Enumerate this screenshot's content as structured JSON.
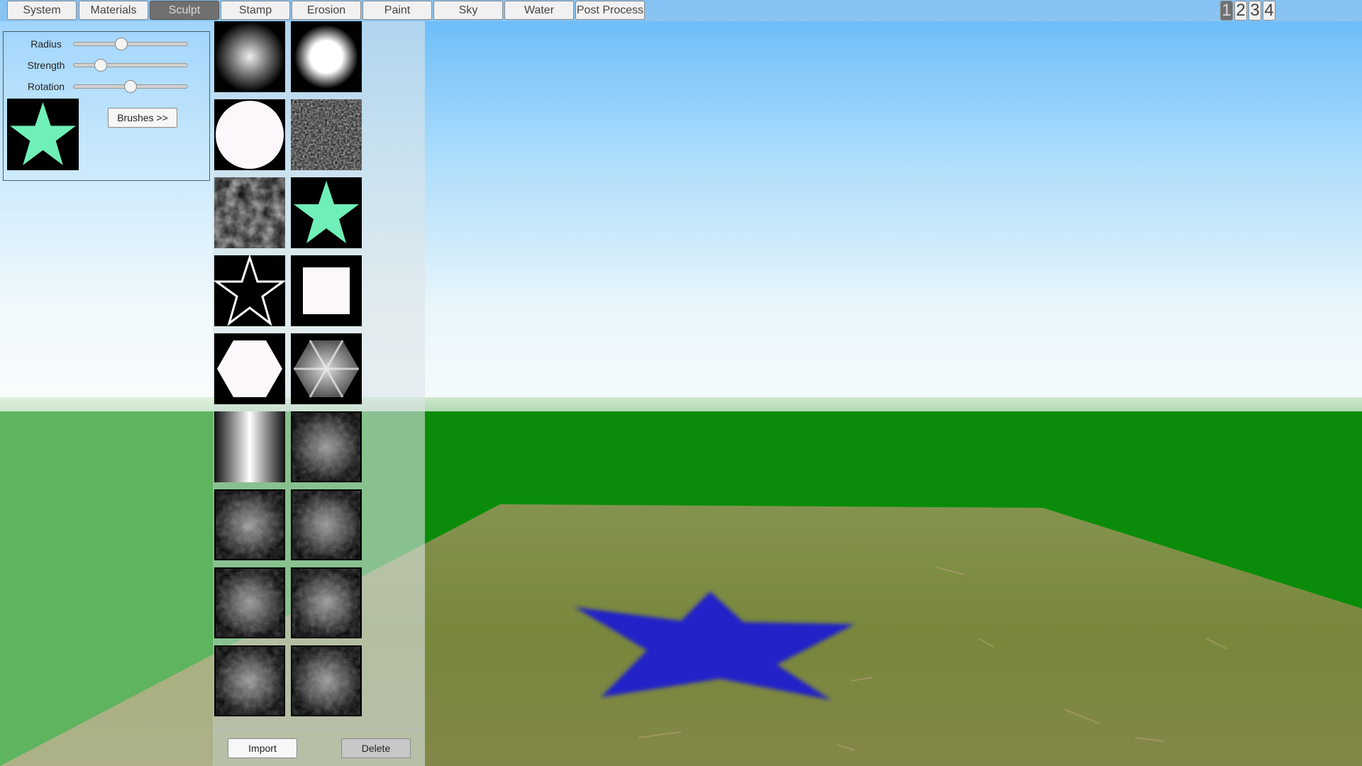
{
  "menu": {
    "tabs": [
      {
        "label": "System"
      },
      {
        "label": "Materials"
      },
      {
        "label": "Sculpt",
        "active": true
      },
      {
        "label": "Stamp"
      },
      {
        "label": "Erosion"
      },
      {
        "label": "Paint"
      },
      {
        "label": "Sky"
      },
      {
        "label": "Water"
      },
      {
        "label": "Post Process"
      }
    ],
    "viewports": [
      {
        "label": "1",
        "active": true
      },
      {
        "label": "2"
      },
      {
        "label": "3"
      },
      {
        "label": "4"
      }
    ]
  },
  "sculpt_panel": {
    "sliders": [
      {
        "label": "Radius",
        "value": 0.42
      },
      {
        "label": "Strength",
        "value": 0.24
      },
      {
        "label": "Rotation",
        "value": 0.5
      }
    ],
    "brushes_button": "Brushes >>",
    "current_brush_icon": "star-brush-icon"
  },
  "brush_library": {
    "brushes": [
      "soft-radial-gradient-brush-icon",
      "hard-glow-circle-brush-icon",
      "solid-circle-brush-icon",
      "noise-circle-brush-icon",
      "cloud-circle-brush-icon",
      "star-brush-icon",
      "star-outline-brush-icon",
      "square-brush-icon",
      "hexagon-brush-icon",
      "hex-rays-brush-icon",
      "vertical-gradient-brush-icon",
      "rock-texture-brush-icon",
      "rock-texture-brush-icon",
      "rock-texture-brush-icon",
      "rock-texture-brush-icon",
      "rock-texture-brush-icon",
      "rock-texture-brush-icon",
      "rock-texture-brush-icon"
    ],
    "import_button": "Import",
    "delete_button": "Delete"
  },
  "colors": {
    "sky_top": "#6ec0fa",
    "sky_horizon": "#f6fbfd",
    "ground_green": "#0a8c0a",
    "terrain": "#7b8b3e",
    "stamp_star": "#2424c8",
    "brush_star": "#6ff0b8"
  }
}
